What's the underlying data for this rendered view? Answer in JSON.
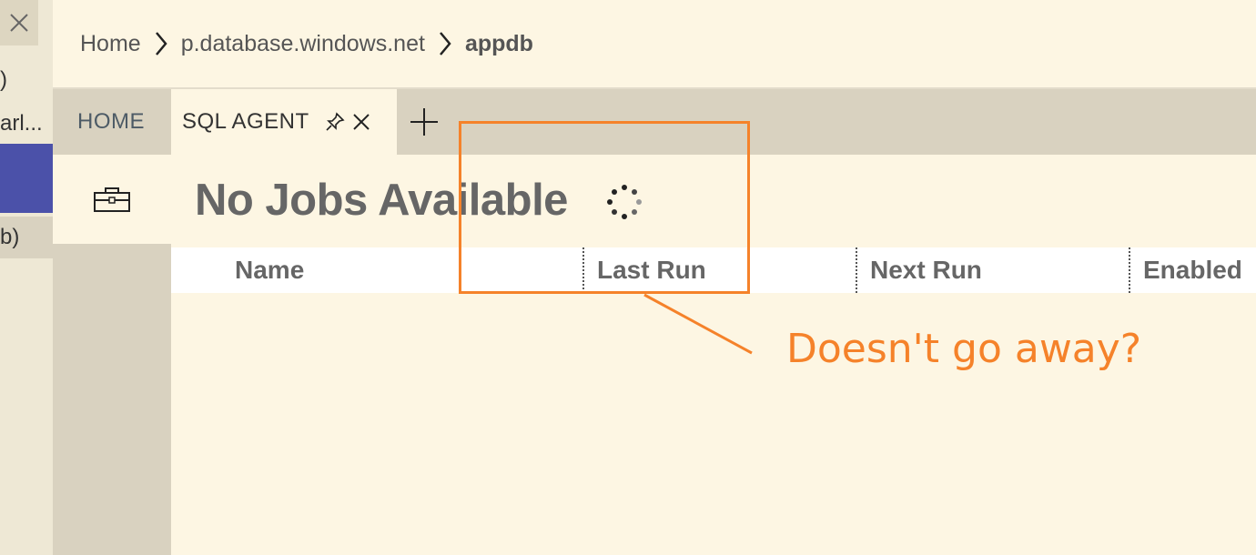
{
  "sidebar": {
    "item1_fragment": ")",
    "item2_fragment": "arl...",
    "item3_fragment": "b)"
  },
  "breadcrumb": {
    "items": [
      "Home",
      "p.database.windows.net",
      "appdb"
    ]
  },
  "tabs": {
    "home_label": "HOME",
    "agent_label": "SQL AGENT"
  },
  "main": {
    "heading": "No Jobs Available",
    "columns": [
      "Name",
      "Last Run",
      "Next Run",
      "Enabled"
    ]
  },
  "annotation": {
    "text": "Doesn't go away?",
    "color": "#f5822a"
  },
  "colors": {
    "background": "#fdf6e3",
    "tabbar": "#d9d2c0",
    "selected_sidebar": "#4b51a9"
  }
}
